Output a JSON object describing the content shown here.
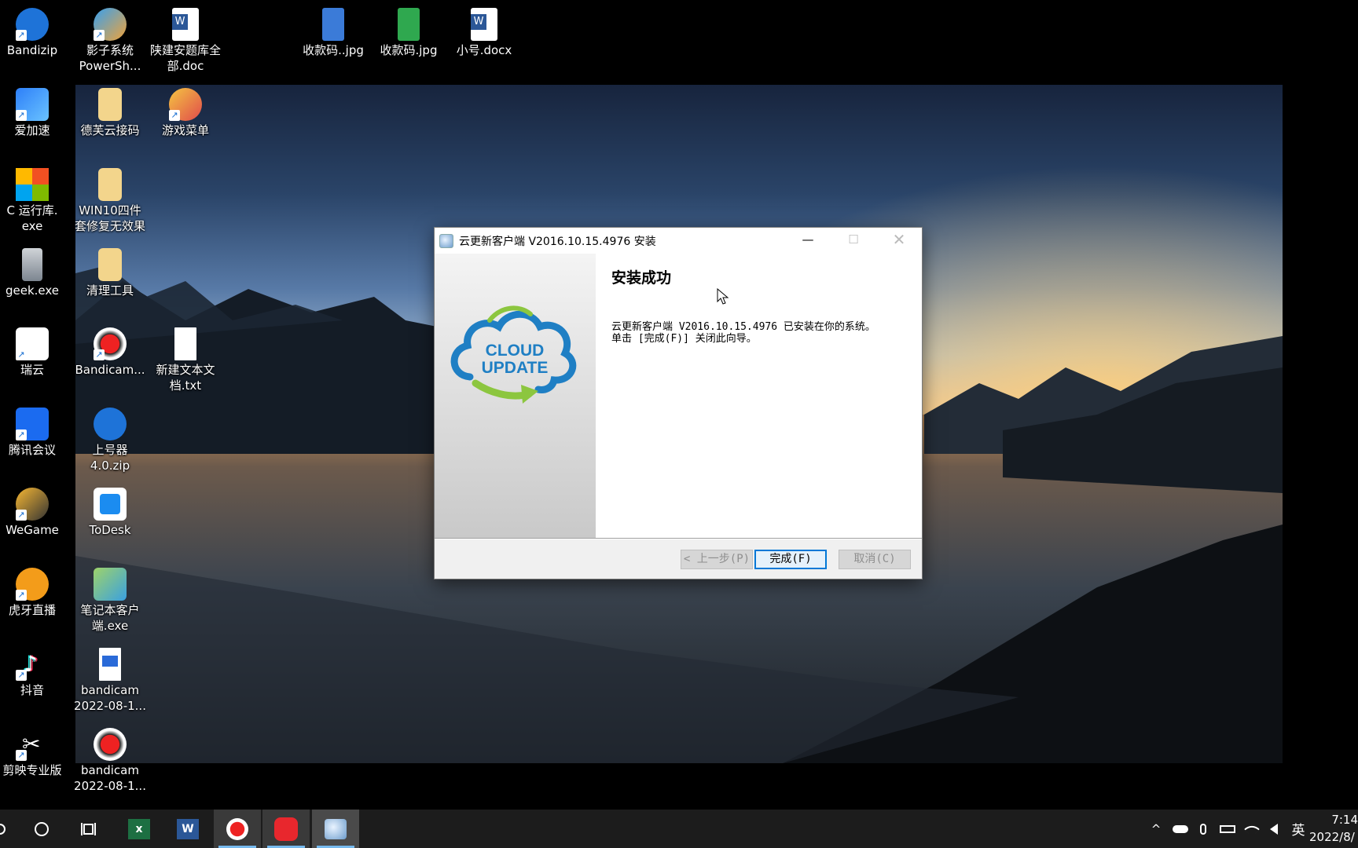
{
  "desktop": {
    "icons": [
      {
        "label": "Bandizip"
      },
      {
        "label": "影子系统\nPowerSh..."
      },
      {
        "label": "陕建安题库全\n部.doc"
      },
      {
        "label": "收款码..jpg"
      },
      {
        "label": "收款码.jpg"
      },
      {
        "label": "小号.docx"
      },
      {
        "label": "爱加速"
      },
      {
        "label": "德芙云接码"
      },
      {
        "label": "游戏菜单"
      },
      {
        "label": "C  运行库.\nexe"
      },
      {
        "label": "WIN10四件\n套修复无效果"
      },
      {
        "label": "geek.exe"
      },
      {
        "label": "清理工具"
      },
      {
        "label": "瑞云"
      },
      {
        "label": "Bandicam..."
      },
      {
        "label": "新建文本文\n档.txt"
      },
      {
        "label": "腾讯会议"
      },
      {
        "label": "上号器\n4.0.zip"
      },
      {
        "label": "WeGame"
      },
      {
        "label": "ToDesk"
      },
      {
        "label": "虎牙直播"
      },
      {
        "label": "笔记本客户\n端.exe"
      },
      {
        "label": "抖音"
      },
      {
        "label": "bandicam\n2022-08-1..."
      },
      {
        "label": "剪映专业版"
      },
      {
        "label": "bandicam\n2022-08-1..."
      }
    ]
  },
  "dialog": {
    "title": "云更新客户端 V2016.10.15.4976 安装",
    "heading": "安装成功",
    "line1": "云更新客户端 V2016.10.15.4976 已安装在你的系统。",
    "line2": "单击 [完成(F)] 关闭此向导。",
    "logo_line1": "CLOUD",
    "logo_line2": "UPDATE",
    "back_label": "< 上一步(P)",
    "finish_label": "完成(F)",
    "cancel_label": "取消(C)",
    "minimize_glyph": "—",
    "maximize_glyph": "☐",
    "close_glyph": "✕"
  },
  "taskbar": {
    "apps": [
      "cortana-icon",
      "task-view-icon",
      "excel-icon",
      "word-icon",
      "bandicam-icon",
      "netease-music-icon",
      "installer-icon"
    ],
    "tray": {
      "chevron": "^",
      "ime": "英"
    },
    "clock_time": "7:14",
    "clock_date": "2022/8/"
  },
  "colors": {
    "accent": "#0078d7",
    "taskbar": "#1c1c1c",
    "logo_blue": "#1f7fc4",
    "logo_green": "#8cc63f"
  }
}
